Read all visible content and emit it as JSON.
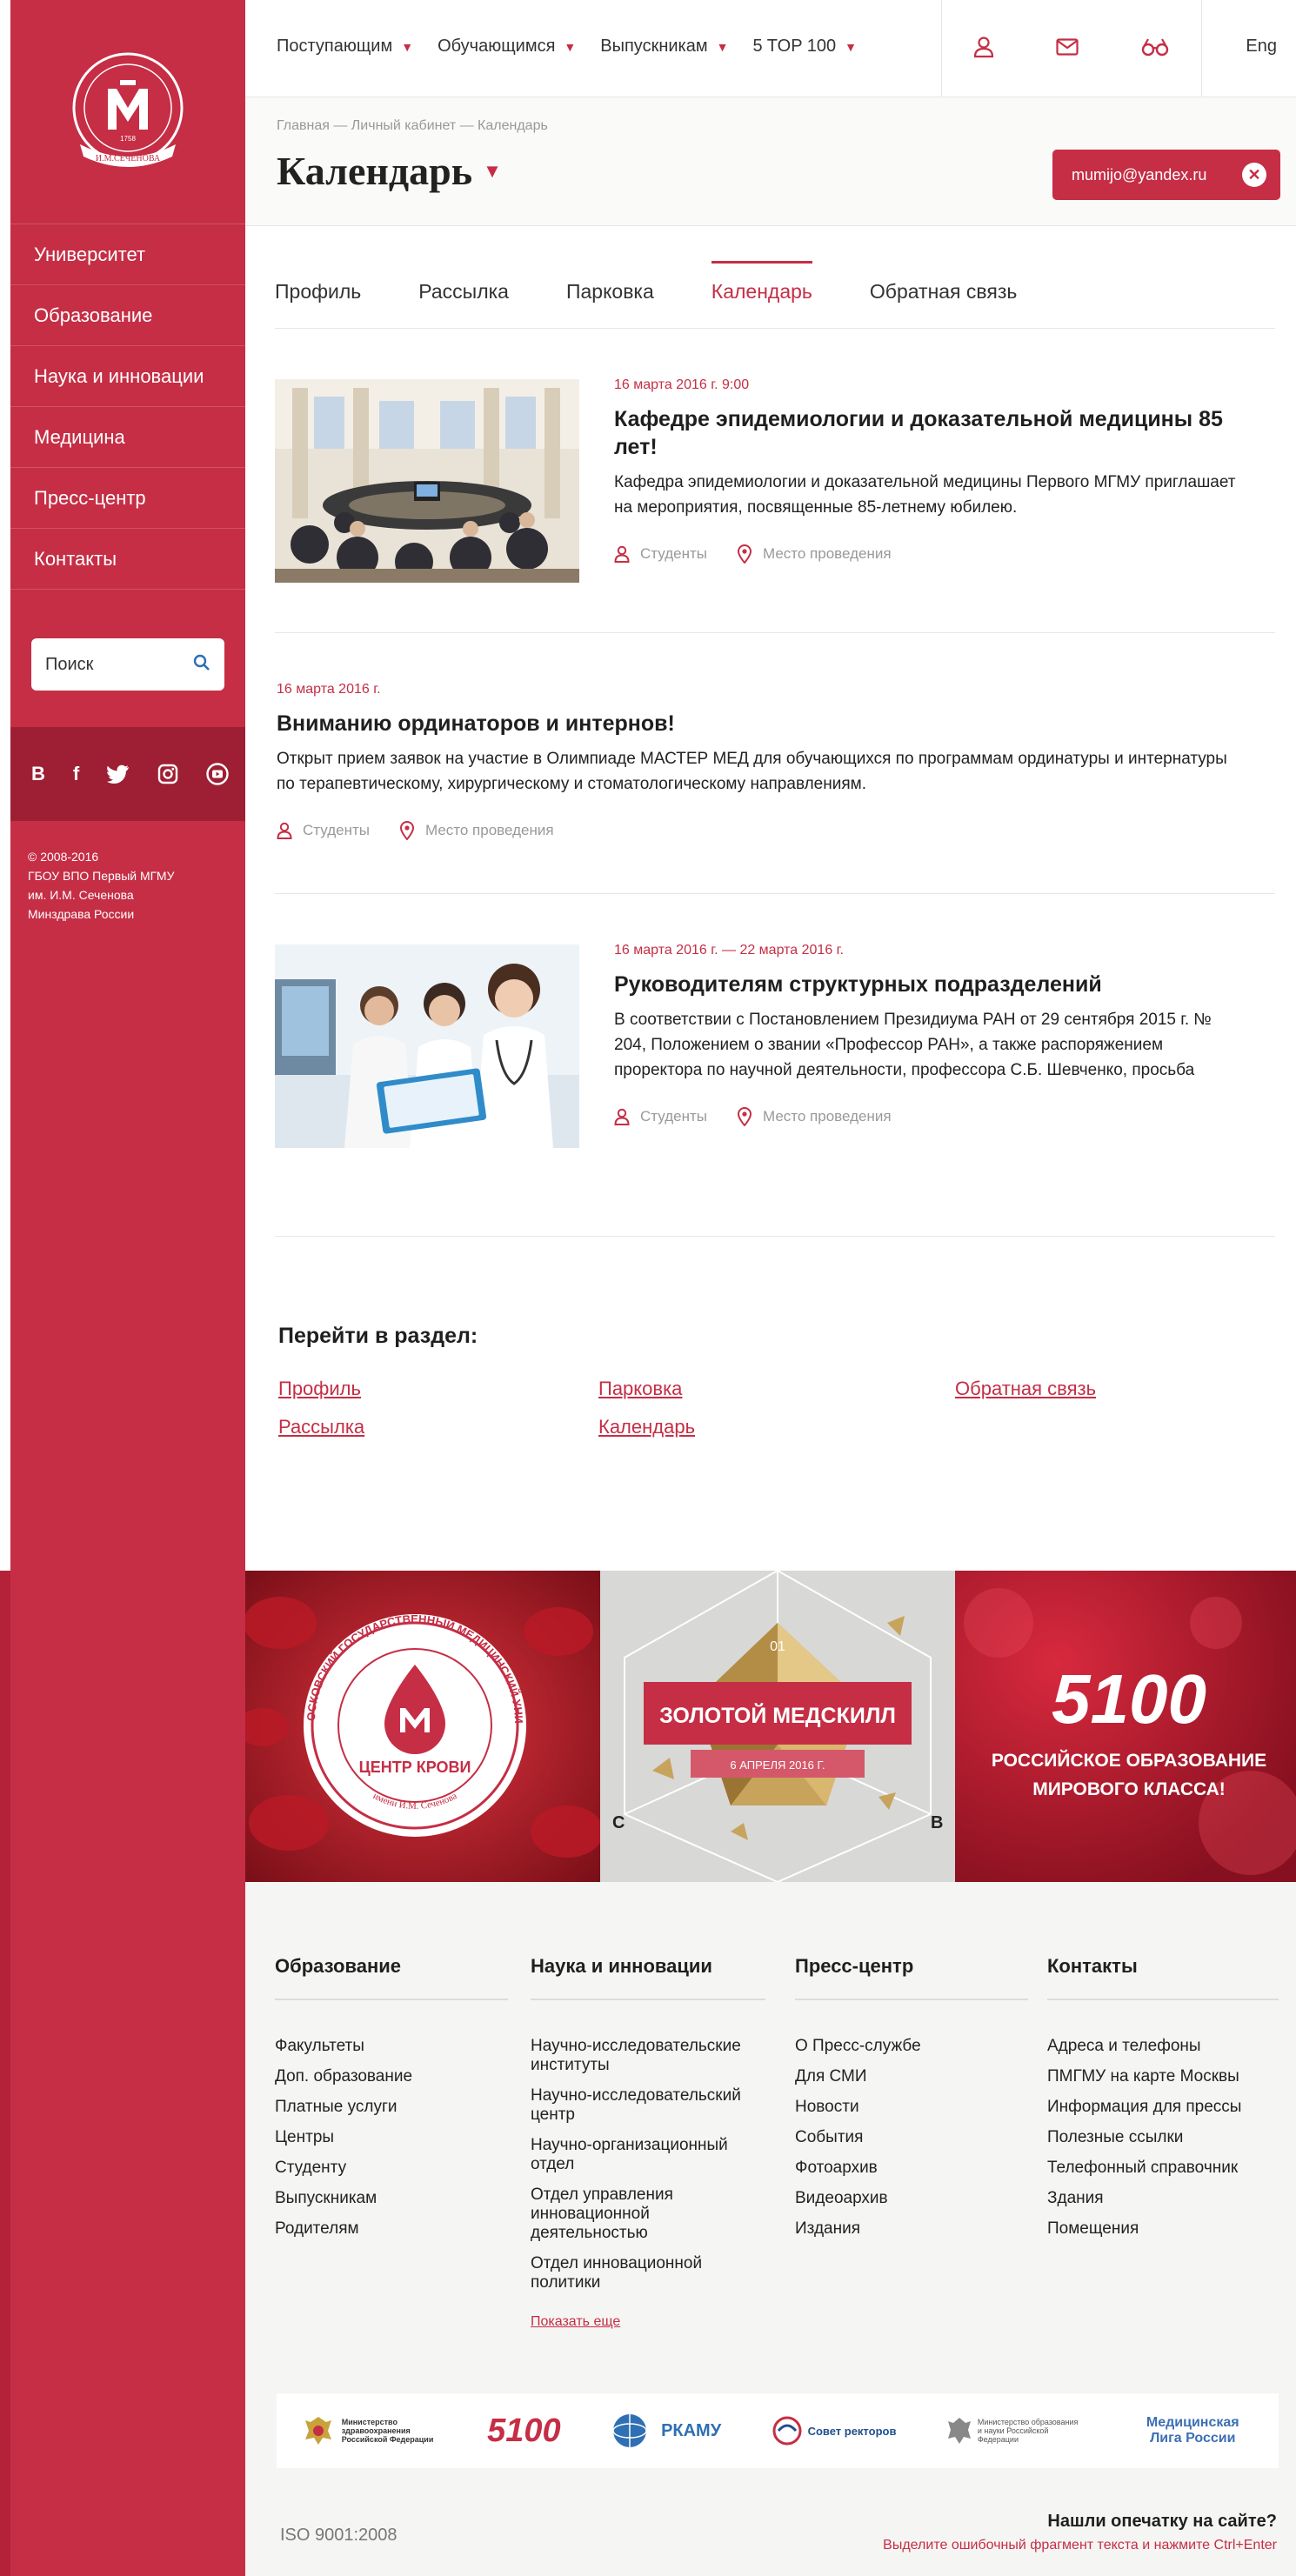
{
  "sidebar": {
    "logo_text": "И.М.СЕЧЕНОВА",
    "logo_year": "1758",
    "items": [
      {
        "label": "Университет"
      },
      {
        "label": "Образование"
      },
      {
        "label": "Наука и инновации"
      },
      {
        "label": "Медицина"
      },
      {
        "label": "Пресс-центр"
      },
      {
        "label": "Контакты"
      }
    ],
    "search_placeholder": "Поиск",
    "social": [
      "В",
      "f"
    ],
    "copyright": [
      "© 2008-2016",
      "ГБОУ ВПО Первый МГМУ",
      "им. И.М. Сеченова",
      "Минздрава России"
    ]
  },
  "topbar": {
    "nav": [
      "Поступающим",
      "Обучающимся",
      "Выпускникам",
      "5 TOP 100"
    ],
    "lang": "Eng",
    "icons": [
      "user-icon",
      "mail-icon",
      "glasses-icon"
    ]
  },
  "header": {
    "breadcrumb": "Главная — Личный кабинет — Календарь",
    "title": "Календарь",
    "email": "mumijo@yandex.ru"
  },
  "tabs": [
    {
      "label": "Профиль",
      "active": false
    },
    {
      "label": "Рассылка",
      "active": false
    },
    {
      "label": "Парковка",
      "active": false
    },
    {
      "label": "Календарь",
      "active": true
    },
    {
      "label": "Обратная связь",
      "active": false
    }
  ],
  "events": [
    {
      "date": "16 марта 2016 г. 9:00",
      "title": "Кафедре эпидемиологии и доказательной медицины 85 лет!",
      "text": "Кафедра эпидемиологии и доказательной медицины Первого МГМУ приглашает на мероприятия, посвященные 85-летнему юбилею.",
      "audience": "Студенты",
      "place": "Место проведения"
    },
    {
      "date": "16 марта 2016 г.",
      "title": "Вниманию ординаторов и интернов!",
      "text": "Открыт прием заявок на участие в Олимпиаде МАСТЕР МЕД для обучающихся по программам ординатуры и интернатуры по терапевтическому, хирургическому и стоматологическому направлениям.",
      "audience": "Студенты",
      "place": "Место проведения"
    },
    {
      "date": "16 марта 2016 г. — 22 марта 2016 г.",
      "title": "Руководителям структурных подразделений",
      "text": "В соответствии с Постановлением Президиума РАН от 29 сентября 2015 г. № 204, Положением о звании «Профессор РАН», а также распоряжением проректора по научной деятельности, профессора С.Б. Шевченко, просьба",
      "audience": "Студенты",
      "place": "Место проведения"
    }
  ],
  "goto": {
    "title": "Перейти в раздел:",
    "links": [
      "Профиль",
      "Рассылка",
      "Парковка",
      "Календарь",
      "Обратная связь"
    ]
  },
  "banners": {
    "blood_center": "ЦЕНТР КРОВИ",
    "blood_ring_top": "ПЕРВЫЙ МОСКОВСКИЙ ГОСУДАРСТВЕННЫЙ МЕДИЦИНСКИЙ УНИВЕРСИТЕТ",
    "blood_ring_bottom": "имени И.М. Сеченова",
    "medskill_num": "01",
    "medskill_title": "ЗОЛОТОЙ МЕДСКИЛЛ",
    "medskill_date": "6 АПРЕЛЯ 2016 Г.",
    "medskill_left": "С",
    "medskill_right": "В",
    "top100_logo": "5100",
    "top100_line1": "РОССИЙСКОЕ ОБРАЗОВАНИЕ",
    "top100_line2": "МИРОВОГО КЛАССА!"
  },
  "footer": {
    "columns": [
      {
        "title": "Образование",
        "items": [
          "Факультеты",
          "Доп. образование",
          "Платные услуги",
          "Центры",
          "Студенту",
          "Выпускникам",
          "Родителям"
        ]
      },
      {
        "title": "Наука и инновации",
        "items": [
          "Научно-исследовательские институты",
          "Научно-исследовательский центр",
          "Научно-организационный отдел",
          "Отдел управления инновационной деятельностью",
          "Отдел инновационной политики"
        ],
        "more": "Показать еще"
      },
      {
        "title": "Пресс-центр",
        "items": [
          "О Пресс-службе",
          "Для СМИ",
          "Новости",
          "События",
          "Фотоархив",
          "Видеоархив",
          "Издания"
        ]
      },
      {
        "title": "Контакты",
        "items": [
          "Адреса и телефоны",
          "ПМГМУ на карте Москвы",
          "Информация для прессы",
          "Полезные ссылки",
          "Телефонный справочник",
          "Здания",
          "Помещения"
        ]
      }
    ],
    "partners": [
      {
        "name": "Министерство здравоохранения Российской Федерации"
      },
      {
        "name": "5100"
      },
      {
        "name": "РКАМУ"
      },
      {
        "name": "Совет ректоров"
      },
      {
        "name": "Министерство образования и науки Российской Федерации"
      },
      {
        "name": "Медицинская Лига России"
      }
    ],
    "iso": "ISO 9001:2008",
    "typo_question": "Нашли опечатку на сайте?",
    "typo_hint": "Выделите ошибочный фрагмент текста и нажмите Ctrl+Enter"
  },
  "colors": {
    "accent": "#c52e45",
    "accent_dark": "#9e1f33",
    "footer_bg": "#f5f5f3"
  }
}
